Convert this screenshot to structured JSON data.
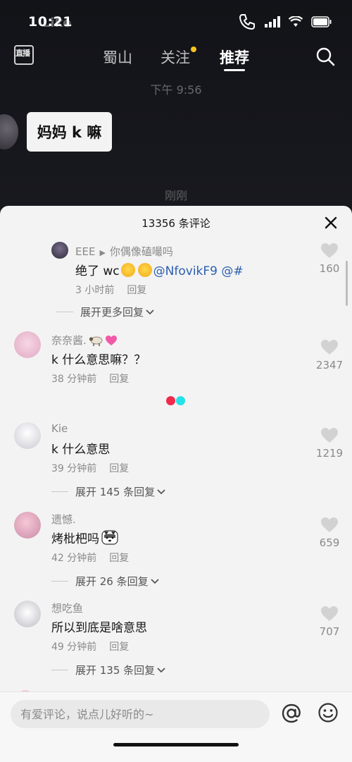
{
  "status_bar": {
    "time": "10:21",
    "ghost_text": "Like"
  },
  "top_nav": {
    "live_label": "直播",
    "tabs": [
      {
        "label": "蜀山"
      },
      {
        "label": "关注"
      },
      {
        "label": "推荐"
      }
    ]
  },
  "chat": {
    "time_1": "下午 9:56",
    "message": "妈妈 k 嘛",
    "time_2": "刚刚"
  },
  "comments_panel": {
    "title": "13356 条评论",
    "comments": [
      {
        "username": "EEE",
        "reply_to": "你偶像磕嘬吗",
        "text_prefix": "绝了 wc",
        "mention": "@NfovikF9 @#",
        "time": "3 小时前",
        "reply_label": "回复",
        "likes": "160",
        "expand_label": "展开更多回复"
      },
      {
        "username": "奈奈酱.",
        "text": "k 什么意思嘛？？",
        "time": "38 分钟前",
        "reply_label": "回复",
        "likes": "2347"
      },
      {
        "username": "Kie",
        "text": "k 什么意思",
        "time": "39 分钟前",
        "reply_label": "回复",
        "likes": "1219",
        "expand_label": "展开 145 条回复"
      },
      {
        "username": "遗憾.",
        "text": "烤枇杷吗",
        "time": "42 分钟前",
        "reply_label": "回复",
        "likes": "659",
        "expand_label": "展开 26 条回复"
      },
      {
        "username": "想吃鱼",
        "text": "所以到底是啥意思",
        "time": "49 分钟前",
        "reply_label": "回复",
        "likes": "707",
        "expand_label": "展开 135 条回复"
      }
    ]
  },
  "composer": {
    "placeholder": "有爱评论，说点儿好听的~"
  },
  "icons": {
    "search": "search-icon",
    "close": "close-icon",
    "heart": "heart-icon",
    "at": "at-icon",
    "emoji": "emoji-icon",
    "chevron": "chevron-down-icon"
  },
  "colors": {
    "accent_red": "#f0294d",
    "accent_cyan": "#25e1e8",
    "mention": "#2a5fb2",
    "follow_dot": "#f5c51f"
  }
}
